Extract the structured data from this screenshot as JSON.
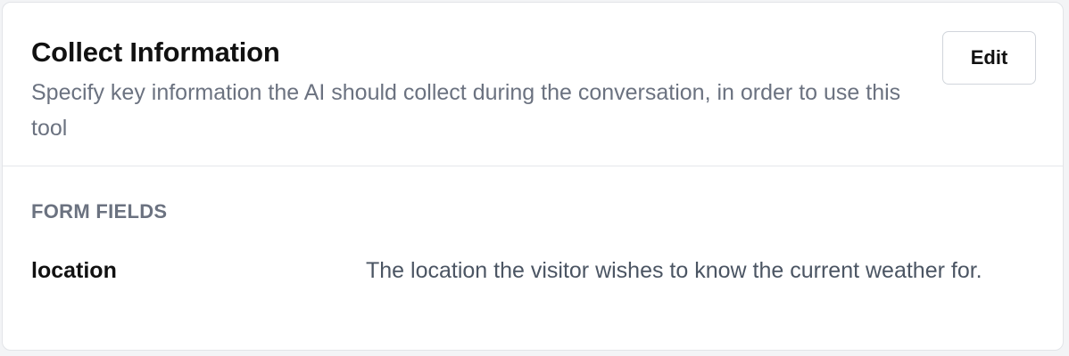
{
  "card": {
    "title": "Collect Information",
    "description": "Specify key information the AI should collect during the conversation, in order to use this tool",
    "edit_label": "Edit"
  },
  "form_fields": {
    "section_label": "FORM FIELDS",
    "items": [
      {
        "name": "location",
        "description": "The location the visitor wishes to know the current weather for."
      }
    ]
  }
}
